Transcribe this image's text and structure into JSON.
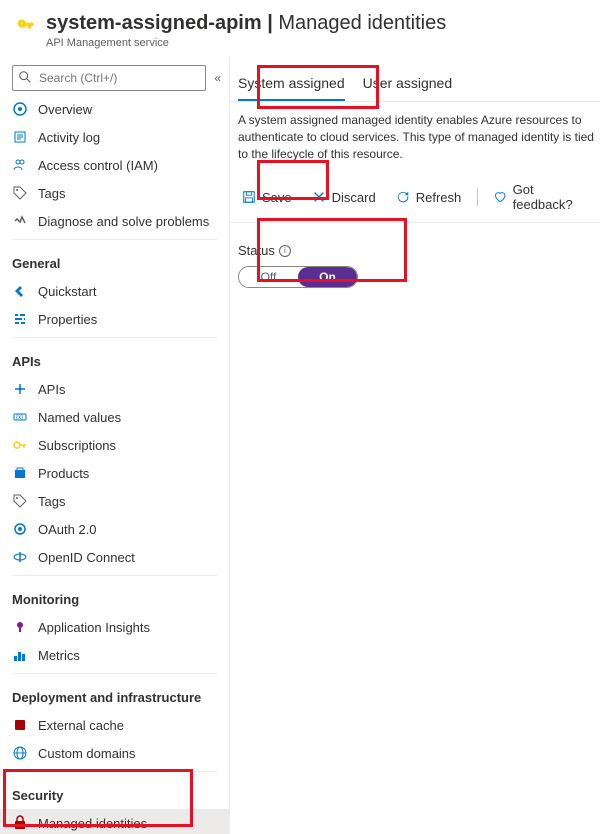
{
  "header": {
    "title_resource": "system-assigned-apim",
    "title_separator": " | ",
    "title_page": "Managed identities",
    "subtitle": "API Management service"
  },
  "search": {
    "placeholder": "Search (Ctrl+/)"
  },
  "sidebar": {
    "top": [
      {
        "label": "Overview",
        "icon": "overview"
      },
      {
        "label": "Activity log",
        "icon": "log"
      },
      {
        "label": "Access control (IAM)",
        "icon": "access"
      },
      {
        "label": "Tags",
        "icon": "tags"
      },
      {
        "label": "Diagnose and solve problems",
        "icon": "diagnose"
      }
    ],
    "sections": [
      {
        "title": "General",
        "items": [
          {
            "label": "Quickstart",
            "icon": "quickstart"
          },
          {
            "label": "Properties",
            "icon": "properties"
          }
        ]
      },
      {
        "title": "APIs",
        "items": [
          {
            "label": "APIs",
            "icon": "apis"
          },
          {
            "label": "Named values",
            "icon": "named"
          },
          {
            "label": "Subscriptions",
            "icon": "key"
          },
          {
            "label": "Products",
            "icon": "products"
          },
          {
            "label": "Tags",
            "icon": "tags"
          },
          {
            "label": "OAuth 2.0",
            "icon": "oauth"
          },
          {
            "label": "OpenID Connect",
            "icon": "openid"
          }
        ]
      },
      {
        "title": "Monitoring",
        "items": [
          {
            "label": "Application Insights",
            "icon": "insights"
          },
          {
            "label": "Metrics",
            "icon": "metrics"
          }
        ]
      },
      {
        "title": "Deployment and infrastructure",
        "items": [
          {
            "label": "External cache",
            "icon": "cache"
          },
          {
            "label": "Custom domains",
            "icon": "domains"
          }
        ]
      },
      {
        "title": "Security",
        "items": [
          {
            "label": "Managed identities",
            "icon": "identity",
            "active": true
          }
        ]
      }
    ]
  },
  "tabs": {
    "system": "System assigned",
    "user": "User assigned"
  },
  "description": "A system assigned managed identity enables Azure resources to authenticate to cloud services. This type of managed identity is tied to the lifecycle of this resource.",
  "toolbar": {
    "save": "Save",
    "discard": "Discard",
    "refresh": "Refresh",
    "feedback": "Got feedback?"
  },
  "status": {
    "label": "Status",
    "off": "Off",
    "on": "On",
    "value": "on"
  },
  "icons": {
    "overview": "#0078d4",
    "log": "#0078d4",
    "access": "#0078d4",
    "tags": "#605e5c",
    "diagnose": "#605e5c",
    "quickstart": "#0078d4",
    "properties": "#0078d4",
    "apis": "#0078d4",
    "named": "#0078d4",
    "key": "#fcd116",
    "products": "#0078d4",
    "oauth": "#0078d4",
    "openid": "#0078d4",
    "insights": "#881798",
    "metrics": "#0078d4",
    "cache": "#a80000",
    "domains": "#0078d4",
    "identity": "#a80000"
  }
}
